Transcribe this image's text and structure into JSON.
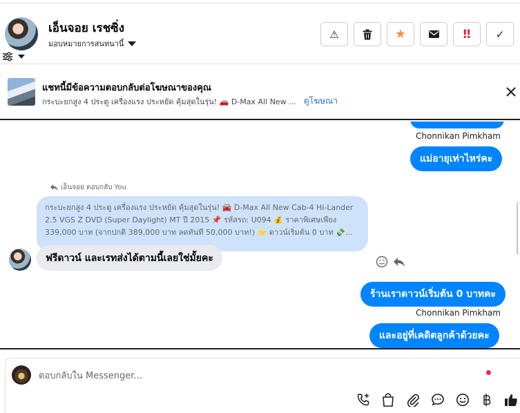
{
  "header": {
    "contact_name": "เอ็นจอย เรชซิ่ง",
    "assign_label": "มอบหมายการสนทนานี้",
    "actions": [
      {
        "name": "report-spam-button",
        "icon": "warning-icon",
        "glyph": "⚠",
        "color": "#1c1e21"
      },
      {
        "name": "delete-button",
        "icon": "trash-icon",
        "glyph": "🗑",
        "color": "#1c1e21"
      },
      {
        "name": "star-button",
        "icon": "star-icon",
        "glyph": "★",
        "color": "#f7923b"
      },
      {
        "name": "mark-unread-button",
        "icon": "envelope-icon",
        "glyph": "✉",
        "color": "#1c1e21"
      },
      {
        "name": "follow-up-button",
        "icon": "double-exclamation-icon",
        "glyph": "‼",
        "color": "#e41e3f"
      },
      {
        "name": "mark-done-button",
        "icon": "check-icon",
        "glyph": "✓",
        "color": "#1c1e21"
      }
    ]
  },
  "banner": {
    "title": "แชทนี้มีข้อความตอบกลับต่อโฆษณาของคุณ",
    "subtitle": "กระบะยกสูง 4 ประตู เครื่องแรง ประหยัด คุ้มสุดในรุ่น! 🚗 D-Max All New ...",
    "link": "ดูโฆษณา"
  },
  "chat": {
    "sender_name": "Chonnikan Pimkham",
    "msg_out_1": "แม่อายุเท่าไหร่คะ",
    "reply_tag": "เอ็นจอย ตอบกลับ You",
    "quoted_lines": [
      "กระบะยกสูง 4 ประตู เครื่องแรง ประหยัด คุ้มสุดในรุ่น! 🚘 D-Max All New Cab-4 Hi-Lander",
      "2.5 VGS Z DVD (Super Daylight) MT ปี 2015 📌 รหัสรถ: U094 💰 ราคาพิเศษเพียง",
      "339,000 บาท (จากปกติ 389,000 บาท ลดทันที 50,000 บาท!) ⭐ ดาวน์เริ่มต้น 0 บาท 💸..."
    ],
    "msg_in": "ฟรีดาวน์ และเรทส่งได้ตามนี้เลยใช่มั้ยคะ",
    "msg_out_2": "ร้านเราดาวน์เริ่มต้น 0 บาทคะ",
    "msg_out_3": "และอยู่ที่เคดิตลูกค้าด้วยคะ"
  },
  "composer": {
    "placeholder": "ตอบกลับใน Messenger..."
  },
  "colors": {
    "accent": "#0084ff",
    "link": "#216fdb",
    "incoming_bubble": "#eaebee",
    "quoted_bubble": "#cfe2fb"
  }
}
